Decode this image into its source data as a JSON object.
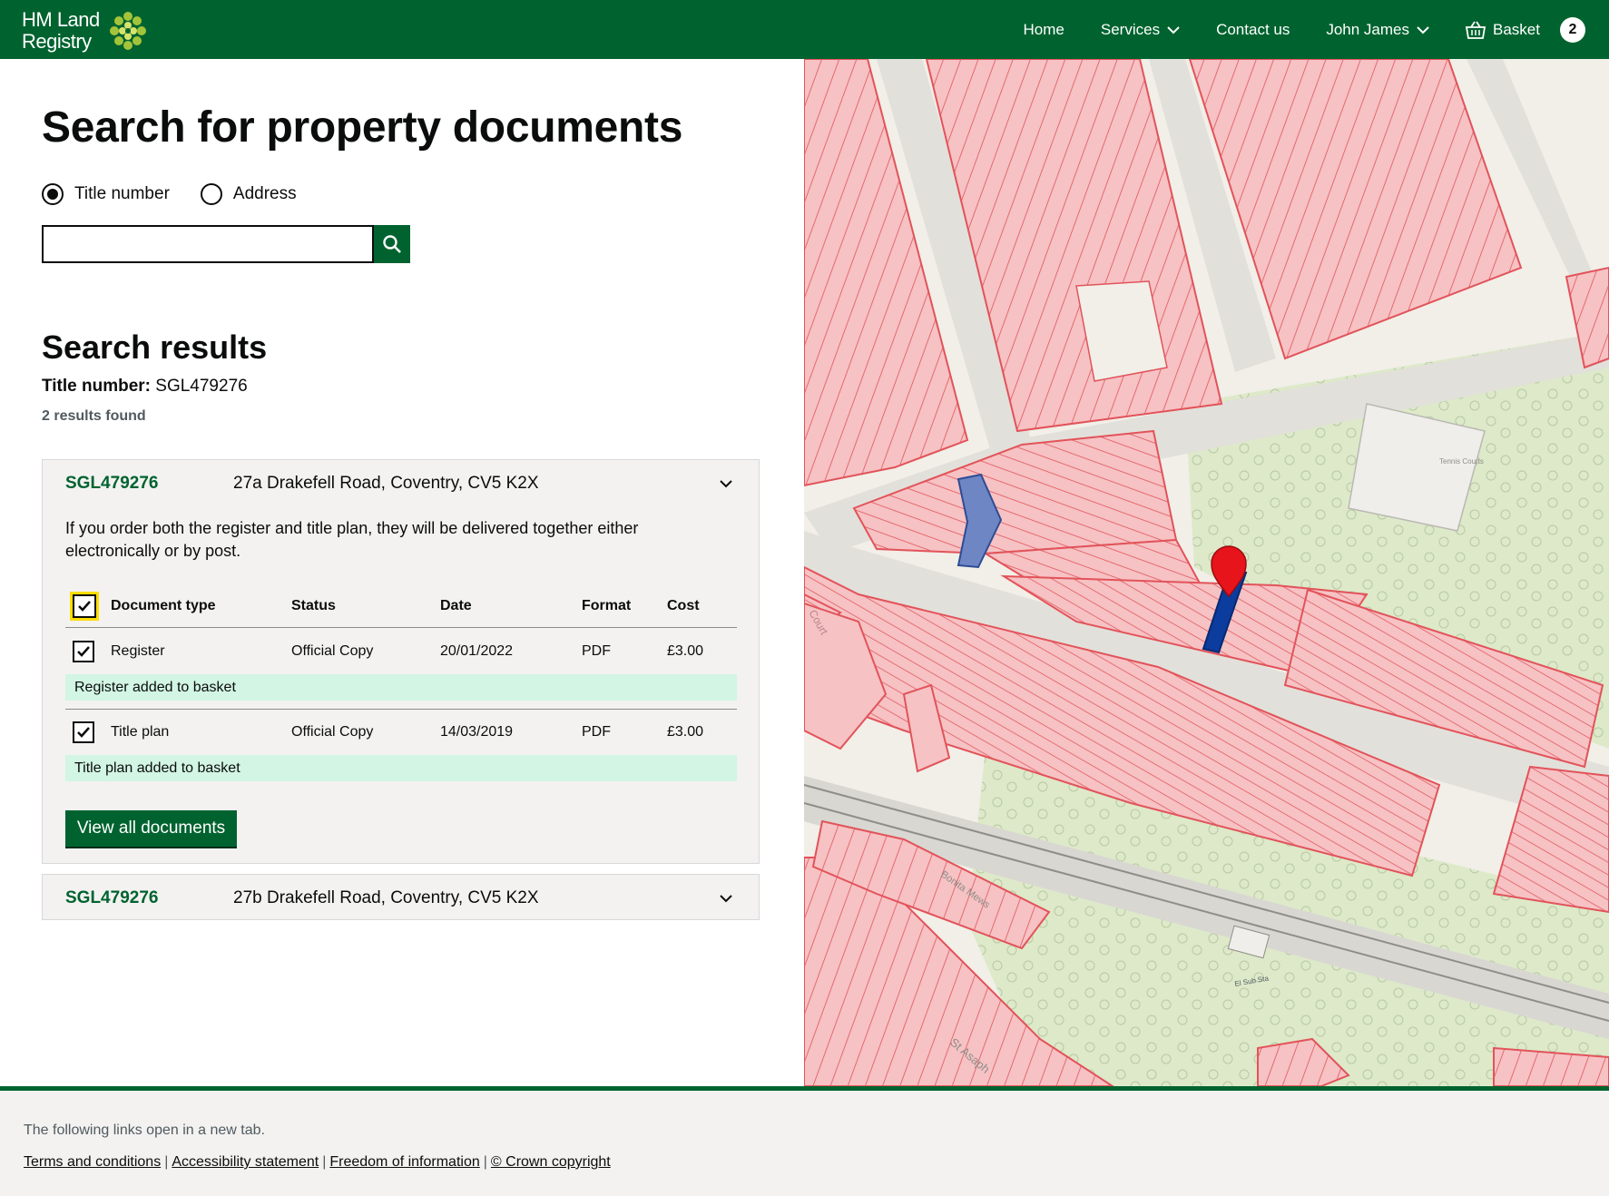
{
  "header": {
    "logo_line1": "HM Land",
    "logo_line2": "Registry",
    "nav": {
      "home": "Home",
      "services": "Services",
      "contact": "Contact us",
      "user": "John James",
      "basket": "Basket",
      "basket_count": "2"
    }
  },
  "search": {
    "heading": "Search for property documents",
    "options": [
      "Title number",
      "Address"
    ],
    "selected_option": "Title number",
    "input_value": "",
    "icon": "search-icon"
  },
  "results": {
    "heading": "Search results",
    "title_label": "Title number:",
    "title_value": "SGL479276",
    "count_text": "2 results found",
    "items": [
      {
        "id": "SGL479276",
        "address": "27a Drakefell Road, Coventry, CV5 K2X",
        "expanded": true,
        "info": "If you order both the register and title plan, they will be delivered together either electronically or by post.",
        "columns": [
          "Document type",
          "Status",
          "Date",
          "Format",
          "Cost"
        ],
        "documents": [
          {
            "type": "Register",
            "status": "Official Copy",
            "date": "20/01/2022",
            "format": "PDF",
            "cost": "£3.00",
            "checked": true,
            "notice": "Register added to basket"
          },
          {
            "type": "Title plan",
            "status": "Official Copy",
            "date": "14/03/2019",
            "format": "PDF",
            "cost": "£3.00",
            "checked": true,
            "notice": "Title plan added to basket"
          }
        ],
        "view_all": "View all documents"
      },
      {
        "id": "SGL479276",
        "address": "27b Drakefell Road, Coventry, CV5 K2X",
        "expanded": false
      }
    ]
  },
  "map": {
    "labels": {
      "tennis": "Tennis Courts",
      "mews": "Bonita Mews",
      "street": "St Asaph",
      "substation": "El Sub Sta",
      "court": "Court"
    },
    "colors": {
      "parcel_fill": "#f6c2c4",
      "parcel_stroke": "#e2535a",
      "selected_parcel": "#0b3c9e",
      "adjacent_parcel": "#6e86c4",
      "marker": "#e8141b"
    }
  },
  "footer": {
    "note": "The following links open in a new tab.",
    "links": [
      "Terms and conditions",
      "Accessibility statement",
      "Freedom of information",
      "© Crown copyright"
    ]
  },
  "colors": {
    "brand": "#00632f",
    "success_bg": "#d2f5e4",
    "focus": "#ffdd00"
  }
}
